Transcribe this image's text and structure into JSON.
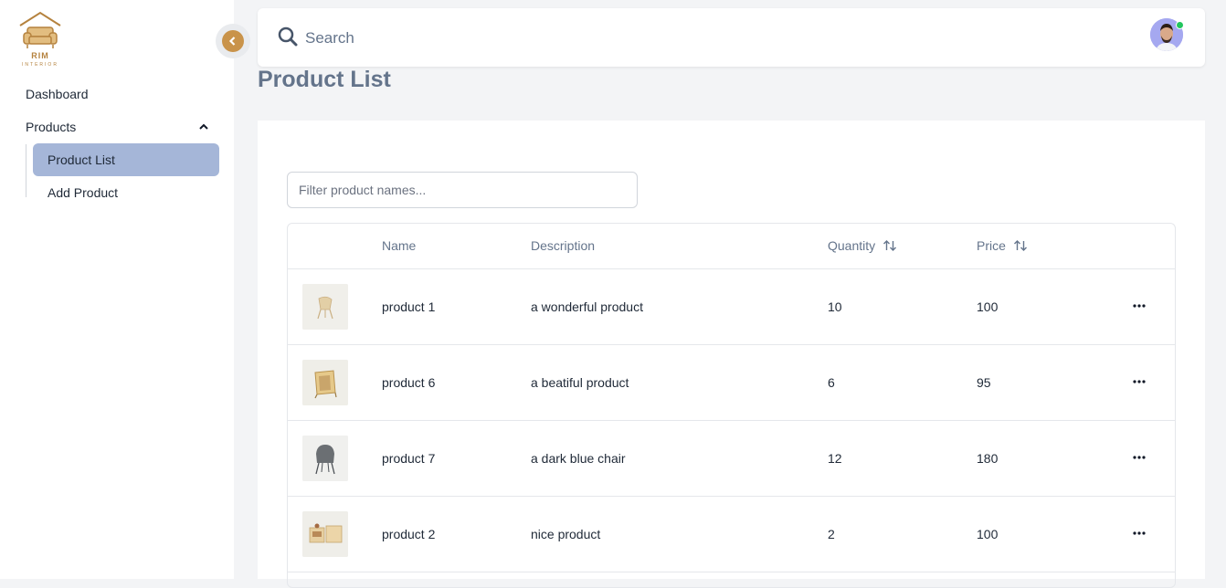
{
  "brand": {
    "logo_text": "RIM",
    "logo_subtext": "INTERIOR"
  },
  "sidebar": {
    "items": [
      {
        "label": "Dashboard"
      },
      {
        "label": "Products",
        "expanded": true,
        "children": [
          {
            "label": "Product List",
            "active": true
          },
          {
            "label": "Add Product",
            "active": false
          }
        ]
      }
    ]
  },
  "header": {
    "search_placeholder": "Search"
  },
  "page": {
    "title": "Product List"
  },
  "filter": {
    "placeholder": "Filter product names...",
    "value": ""
  },
  "table": {
    "columns": [
      "",
      "Name",
      "Description",
      "Quantity",
      "Price",
      ""
    ],
    "sortable": [
      "Quantity",
      "Price"
    ],
    "rows": [
      {
        "name": "product 1",
        "description": "a wonderful product",
        "quantity": "10",
        "price": "100"
      },
      {
        "name": "product 6",
        "description": "a beatiful product",
        "quantity": "6",
        "price": "95"
      },
      {
        "name": "product 7",
        "description": "a dark blue chair",
        "quantity": "12",
        "price": "180"
      },
      {
        "name": "product 2",
        "description": "nice product",
        "quantity": "2",
        "price": "100"
      }
    ]
  },
  "colors": {
    "accent": "#c9934a",
    "active_nav_bg": "#a5b6d8",
    "title": "#64748b",
    "status_online": "#22c55e"
  },
  "icons": [
    "logo-icon",
    "chevron-left-icon",
    "chevron-up-icon",
    "search-icon",
    "sort-icon",
    "more-horizontal-icon",
    "user-avatar"
  ]
}
